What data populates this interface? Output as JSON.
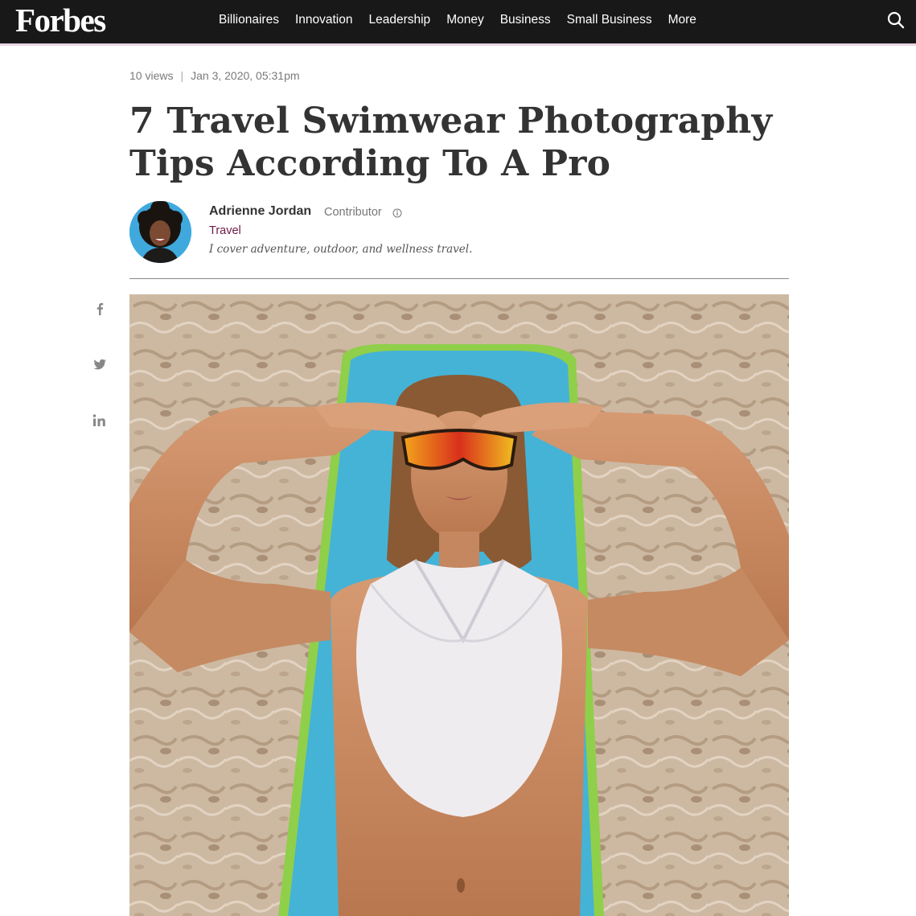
{
  "brand": {
    "logo_text": "Forbes"
  },
  "nav": {
    "items": [
      {
        "label": "Billionaires"
      },
      {
        "label": "Innovation"
      },
      {
        "label": "Leadership"
      },
      {
        "label": "Money"
      },
      {
        "label": "Business"
      },
      {
        "label": "Small Business"
      },
      {
        "label": "More"
      }
    ],
    "search_icon": "search-icon"
  },
  "article": {
    "views": "10 views",
    "separator": "|",
    "date": "Jan 3, 2020, 05:31pm",
    "headline": "7 Travel Swimwear Photography Tips According To A Pro"
  },
  "author": {
    "name": "Adrienne Jordan",
    "role": "Contributor",
    "section": "Travel",
    "bio": "I cover adventure, outdoor, and wellness travel."
  },
  "share": {
    "icons": [
      "facebook-icon",
      "twitter-icon",
      "linkedin-icon"
    ]
  },
  "colors": {
    "topbar": "#181818",
    "section_link": "#6b1c46",
    "text": "#333333"
  }
}
